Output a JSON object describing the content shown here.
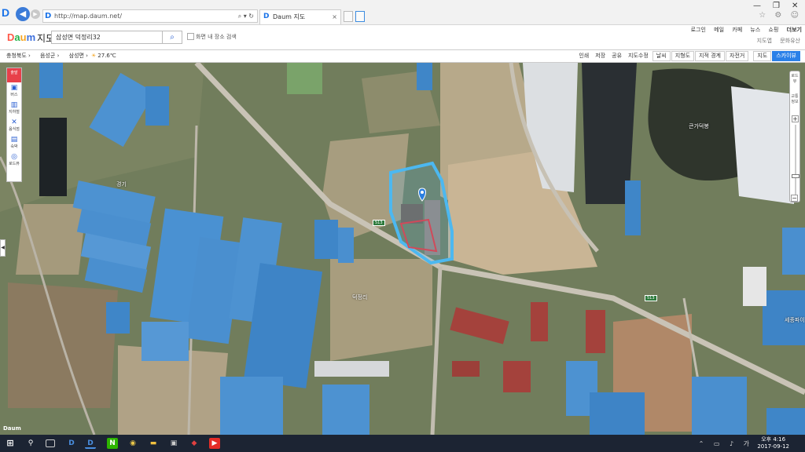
{
  "browser": {
    "url": "http://map.daum.net/",
    "tab_title": "Daum 지도",
    "tab_close": "×",
    "favicon": "D",
    "back": "◀",
    "forward": "▶",
    "addr_tools": "⌕ ▾ ↻",
    "window_controls": [
      "—",
      "❐",
      "✕"
    ],
    "chrome_icons": "☆ ⚙ ☺"
  },
  "header": {
    "logo": [
      "D",
      "a",
      "u",
      "m"
    ],
    "title": "지도",
    "search_value": "삼성면 덕정리32",
    "search_icon": "⌕",
    "checkbox_label": "화면 내 장소 검색",
    "services": [
      "로그인",
      "메일",
      "카페",
      "뉴스",
      "쇼핑",
      "더보기"
    ],
    "services2": [
      "지도앱",
      "문화유산"
    ]
  },
  "toolbar": {
    "location": [
      "충청북도 ›",
      "음성군 ›",
      "삼성면 ›"
    ],
    "weather_icon": "☀",
    "weather": "27.6℃",
    "right_items": [
      "인쇄",
      "저장",
      "공유",
      "지도수정"
    ],
    "right_boxes": [
      "날씨",
      "지형도",
      "지적 경계",
      "자전거",
      "지도",
      "스카이뷰"
    ]
  },
  "left_panel": [
    {
      "icon": "출발",
      "label": ""
    },
    {
      "icon": "▣",
      "label": "버스"
    },
    {
      "icon": "▥",
      "label": "지하철"
    },
    {
      "icon": "✕",
      "label": "음식점"
    },
    {
      "icon": "▤",
      "label": "숙박"
    },
    {
      "icon": "◎",
      "label": "로드뷰"
    }
  ],
  "collapse_arrow": "◀",
  "zoom": {
    "road_label": "로드뷰",
    "realtime_label": "교통정보",
    "plus": "+",
    "minus": "−",
    "level_fraction": 0.72
  },
  "map_labels": {
    "pond": "큰가덕봉",
    "label2": "경기",
    "label3": "덕정리",
    "label4": "세종파이",
    "footer": "Daum"
  },
  "road_badges": [
    "513",
    "513"
  ],
  "taskbar": {
    "start": "⊞",
    "search": "⚲",
    "apps": [
      "D",
      "D",
      "N",
      "◉",
      "▬",
      "▣",
      "◆",
      "▶"
    ],
    "tray": "⌃ ▭ ♪ 가",
    "time": "오후 4:16",
    "date": "2017-09-12"
  }
}
